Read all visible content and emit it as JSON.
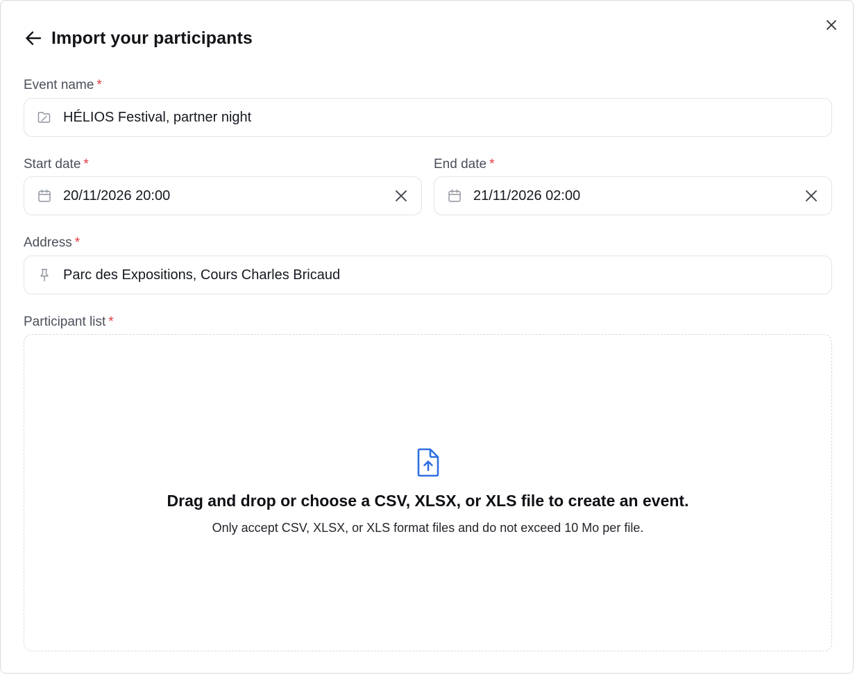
{
  "dialog": {
    "title": "Import your participants"
  },
  "form": {
    "required_marker": "*",
    "event_name": {
      "label": "Event name",
      "value": "HÉLIOS Festival, partner night",
      "icon": "folder-icon"
    },
    "start_date": {
      "label": "Start date",
      "value": "20/11/2026 20:00",
      "icon": "calendar-icon"
    },
    "end_date": {
      "label": "End date",
      "value": "21/11/2026 02:00",
      "icon": "calendar-icon"
    },
    "address": {
      "label": "Address",
      "value": "Parc des Expositions, Cours Charles Bricaud",
      "icon": "pin-icon"
    },
    "participant_list": {
      "label": "Participant list",
      "dropzone_title": "Drag and drop or choose a CSV, XLSX, or XLS file to create an event.",
      "dropzone_subtitle": "Only accept CSV, XLSX, or XLS format files and do not exceed 10 Mo per file.",
      "icon": "file-upload-icon"
    }
  },
  "colors": {
    "accent": "#2f6fe0",
    "required": "#e0393e",
    "border": "#e1e3e8"
  }
}
